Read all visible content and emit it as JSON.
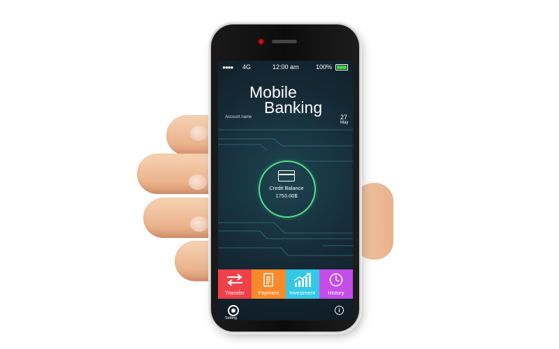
{
  "status_bar": {
    "signal": "●●●●",
    "network": "4G",
    "time": "12:00 am",
    "battery": "100%",
    "battery_level": 1.0,
    "battery_color": "#3ed43e"
  },
  "app": {
    "title_line1": "Mobile",
    "title_line2": "Banking",
    "account_label": "Account name",
    "date_day": "27",
    "date_month": "May"
  },
  "balance": {
    "label": "Credit Balance",
    "amount": "1753.00$",
    "ring_color": "#4fe08a",
    "icon": "credit-card-icon"
  },
  "actions": [
    {
      "label": "Transfer",
      "icon": "transfer-arrows-icon",
      "color": "#f0404a"
    },
    {
      "label": "Payment",
      "icon": "receipt-icon",
      "color": "#f98a2c"
    },
    {
      "label": "Investment",
      "icon": "growth-chart-icon",
      "color": "#33c8e6"
    },
    {
      "label": "History",
      "icon": "clock-icon",
      "color": "#c44de8"
    }
  ],
  "footer": {
    "setting_label": "Setting",
    "setting_icon": "gear-icon",
    "info_icon": "info-icon"
  }
}
